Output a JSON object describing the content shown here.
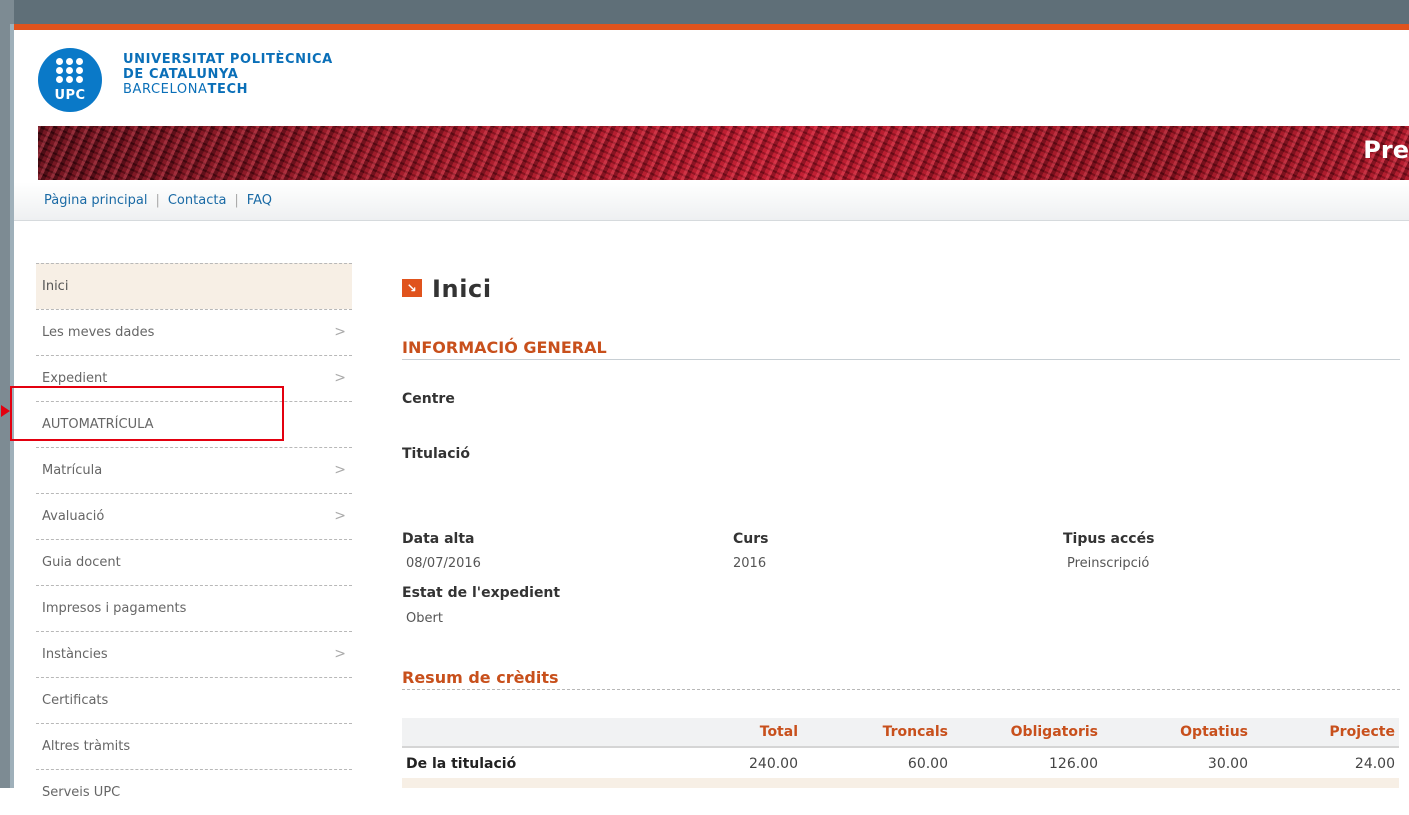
{
  "header": {
    "logo_text": "UPC",
    "uni_line1": "UNIVERSITAT POLITÈCNICA",
    "uni_line2": "DE CATALUNYA",
    "uni_line3_a": "BARCELONA",
    "uni_line3_b": "TECH",
    "banner_text": "Pre"
  },
  "topnav": {
    "items": [
      "Pàgina principal",
      "Contacta",
      "FAQ"
    ]
  },
  "sidebar": {
    "items": [
      {
        "label": "Inici",
        "chevron": ""
      },
      {
        "label": "Les meves dades",
        "chevron": ">"
      },
      {
        "label": "Expedient",
        "chevron": ">"
      },
      {
        "label": "AUTOMATRÍCULA",
        "chevron": ""
      },
      {
        "label": "Matrícula",
        "chevron": ">"
      },
      {
        "label": "Avaluació",
        "chevron": ">"
      },
      {
        "label": "Guia docent",
        "chevron": ""
      },
      {
        "label": "Impresos i pagaments",
        "chevron": ""
      },
      {
        "label": "Instàncies",
        "chevron": ">"
      },
      {
        "label": "Certificats",
        "chevron": ""
      },
      {
        "label": "Altres tràmits",
        "chevron": ""
      },
      {
        "label": "Serveis UPC",
        "chevron": ""
      }
    ]
  },
  "main": {
    "title": "Inici",
    "general_heading": "INFORMACIÓ GENERAL",
    "centre_label": "Centre",
    "titulacio_label": "Titulació",
    "data_alta_label": "Data alta",
    "data_alta_value": "08/07/2016",
    "curs_label": "Curs",
    "curs_value": "2016",
    "tipus_acces_label": "Tipus accés",
    "tipus_acces_value": "Preinscripció",
    "estat_label": "Estat de l'expedient",
    "estat_value": "Obert",
    "credits_heading": "Resum de crèdits",
    "credits_table": {
      "headers": [
        "",
        "Total",
        "Troncals",
        "Obligatoris",
        "Optatius",
        "Projecte"
      ],
      "rows": [
        [
          "De la titulació",
          "240.00",
          "60.00",
          "126.00",
          "30.00",
          "24.00"
        ]
      ]
    }
  },
  "colors": {
    "accent_orange": "#e0531d",
    "heading_orange": "#c8501c",
    "link_blue": "#1a6aa5",
    "upc_blue": "#0a79c8",
    "highlight_red": "#e3000f"
  }
}
